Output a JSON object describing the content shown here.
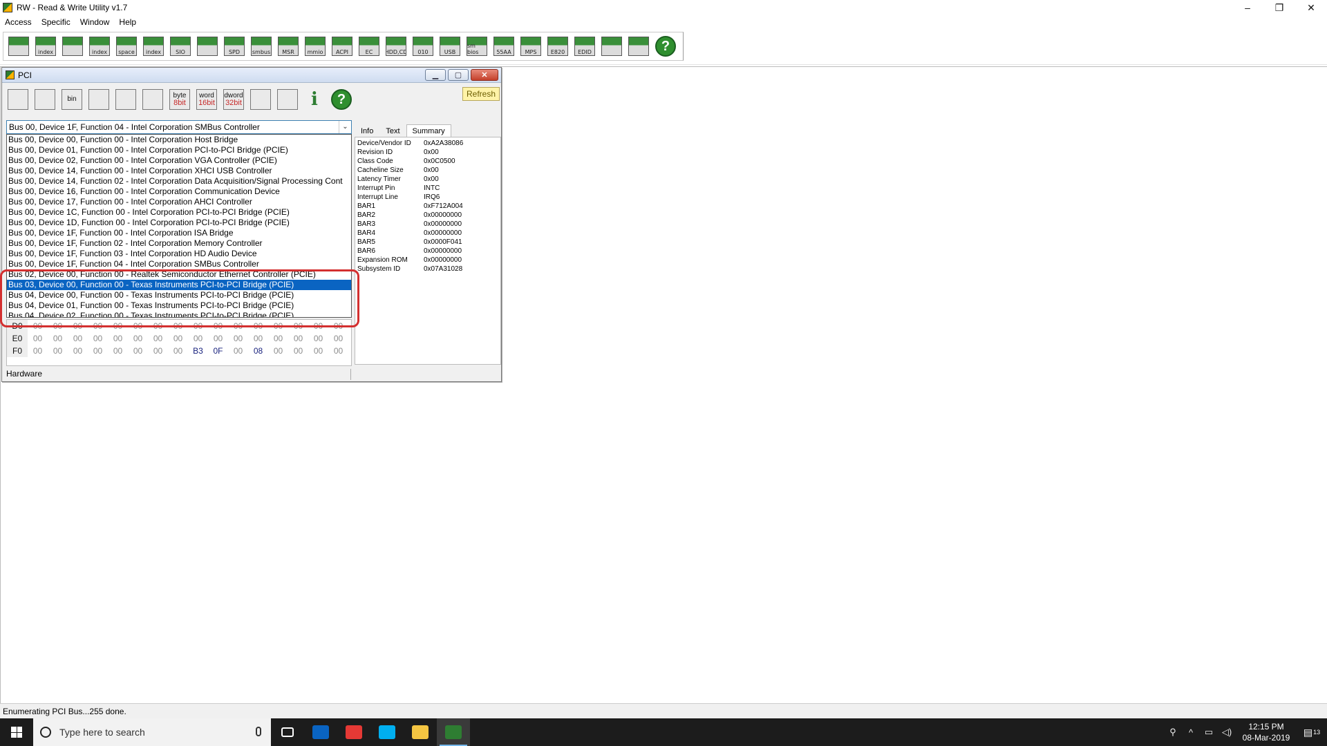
{
  "app": {
    "title": "RW - Read & Write Utility v1.7",
    "controls": {
      "minimize": "–",
      "restore": "❐",
      "close": "✕"
    }
  },
  "menu": [
    "Access",
    "Specific",
    "Window",
    "Help"
  ],
  "main_toolbar": {
    "buttons": [
      {
        "name": "pci-icon",
        "label": ""
      },
      {
        "name": "pci-index-icon",
        "label": "index"
      },
      {
        "name": "memory-icon",
        "label": ""
      },
      {
        "name": "memory-index-icon",
        "label": "index"
      },
      {
        "name": "io-space-icon",
        "label": "space"
      },
      {
        "name": "io-index-icon",
        "label": "index"
      },
      {
        "name": "sio-icon",
        "label": "SIO"
      },
      {
        "name": "oscilloscope-icon",
        "label": ""
      },
      {
        "name": "spd-icon",
        "label": "SPD"
      },
      {
        "name": "smbus-icon",
        "label": "smbus"
      },
      {
        "name": "msr-icon",
        "label": "MSR"
      },
      {
        "name": "mmio-icon",
        "label": "mmio"
      },
      {
        "name": "acpi-icon",
        "label": "ACPI"
      },
      {
        "name": "ec-icon",
        "label": "EC"
      },
      {
        "name": "hdd-icon",
        "label": "HDD,CD"
      },
      {
        "name": "cmos-icon",
        "label": "010"
      },
      {
        "name": "usb-icon",
        "label": "USB"
      },
      {
        "name": "smbios-icon",
        "label": "sm bios"
      },
      {
        "name": "rom-55aa-icon",
        "label": "55AA"
      },
      {
        "name": "mps-icon",
        "label": "MPS"
      },
      {
        "name": "e820-icon",
        "label": "E820"
      },
      {
        "name": "edid-icon",
        "label": "EDID"
      },
      {
        "name": "command-icon",
        "label": ""
      },
      {
        "name": "tools-icon",
        "label": ""
      }
    ],
    "colors": {
      "accent": "#2e7d32"
    }
  },
  "pci_window": {
    "title": "PCI",
    "controls": {
      "minimize": "▁",
      "maximize": "▢",
      "close": "✕"
    },
    "toolbar": {
      "buttons": [
        {
          "name": "save-icon",
          "top": "",
          "bottom": ""
        },
        {
          "name": "save-all-icon",
          "top": "",
          "bottom": ""
        },
        {
          "name": "bin-icon",
          "top": "bin",
          "bottom": ""
        },
        {
          "name": "open-icon",
          "top": "",
          "bottom": ""
        },
        {
          "name": "find-icon",
          "top": "",
          "bottom": ""
        },
        {
          "name": "window-icon",
          "top": "",
          "bottom": ""
        },
        {
          "name": "byte-icon",
          "top": "byte",
          "bottom": "8bit"
        },
        {
          "name": "word-icon",
          "top": "word",
          "bottom": "16bit"
        },
        {
          "name": "dword-icon",
          "top": "dword",
          "bottom": "32bit"
        },
        {
          "name": "list-icon",
          "top": "",
          "bottom": ""
        },
        {
          "name": "disc-icon",
          "top": "",
          "bottom": ""
        }
      ],
      "refresh_label": "Refresh"
    },
    "device_selector": {
      "selected_value": "Bus 00, Device 1F, Function 04 - Intel Corporation SMBus Controller",
      "options": [
        "Bus 00, Device 00, Function 00 - Intel Corporation Host Bridge",
        "Bus 00, Device 01, Function 00 - Intel Corporation PCI-to-PCI Bridge (PCIE)",
        "Bus 00, Device 02, Function 00 - Intel Corporation VGA Controller (PCIE)",
        "Bus 00, Device 14, Function 00 - Intel Corporation XHCI USB Controller",
        "Bus 00, Device 14, Function 02 - Intel Corporation Data Acquisition/Signal Processing Cont",
        "Bus 00, Device 16, Function 00 - Intel Corporation Communication Device",
        "Bus 00, Device 17, Function 00 - Intel Corporation AHCI Controller",
        "Bus 00, Device 1C, Function 00 - Intel Corporation PCI-to-PCI Bridge (PCIE)",
        "Bus 00, Device 1D, Function 00 - Intel Corporation PCI-to-PCI Bridge (PCIE)",
        "Bus 00, Device 1F, Function 00 - Intel Corporation ISA Bridge",
        "Bus 00, Device 1F, Function 02 - Intel Corporation Memory Controller",
        "Bus 00, Device 1F, Function 03 - Intel Corporation HD Audio Device",
        "Bus 00, Device 1F, Function 04 - Intel Corporation SMBus Controller",
        "Bus 02, Device 00, Function 00 - Realtek Semiconductor Ethernet Controller (PCIE)",
        "Bus 03, Device 00, Function 00 - Texas Instruments PCI-to-PCI Bridge (PCIE)",
        "Bus 04, Device 00, Function 00 - Texas Instruments PCI-to-PCI Bridge (PCIE)",
        "Bus 04, Device 01, Function 00 - Texas Instruments PCI-to-PCI Bridge (PCIE)",
        "Bus 04, Device 02, Function 00 - Texas Instruments PCI-to-PCI Bridge (PCIE)"
      ],
      "highlighted_index": 14,
      "annotation_color": "#d32f2f"
    },
    "hex_rows": [
      {
        "label": "D0",
        "cells": [
          "00",
          "00",
          "00",
          "00",
          "00",
          "00",
          "00",
          "00",
          "00",
          "00",
          "00",
          "00",
          "00",
          "00",
          "00",
          "00"
        ]
      },
      {
        "label": "E0",
        "cells": [
          "00",
          "00",
          "00",
          "00",
          "00",
          "00",
          "00",
          "00",
          "00",
          "00",
          "00",
          "00",
          "00",
          "00",
          "00",
          "00"
        ]
      },
      {
        "label": "F0",
        "cells": [
          "00",
          "00",
          "00",
          "00",
          "00",
          "00",
          "00",
          "00",
          "B3",
          "0F",
          "00",
          "08",
          "00",
          "00",
          "00",
          "00"
        ]
      }
    ],
    "status_label": "Hardware",
    "tabs": [
      "Info",
      "Text",
      "Summary"
    ],
    "active_tab": 2,
    "summary": [
      {
        "key": "Device/Vendor ID",
        "value": "0xA2A38086"
      },
      {
        "key": "Revision ID",
        "value": "0x00"
      },
      {
        "key": "Class Code",
        "value": "0x0C0500"
      },
      {
        "key": "Cacheline Size",
        "value": "0x00"
      },
      {
        "key": "Latency Timer",
        "value": "0x00"
      },
      {
        "key": "Interrupt Pin",
        "value": "INTC"
      },
      {
        "key": "Interrupt Line",
        "value": "IRQ6"
      },
      {
        "key": "BAR1",
        "value": "0xF712A004"
      },
      {
        "key": "BAR2",
        "value": "0x00000000"
      },
      {
        "key": "BAR3",
        "value": "0x00000000"
      },
      {
        "key": "BAR4",
        "value": "0x00000000"
      },
      {
        "key": "BAR5",
        "value": "0x0000F041"
      },
      {
        "key": "BAR6",
        "value": "0x00000000"
      },
      {
        "key": "Expansion ROM",
        "value": "0x00000000"
      },
      {
        "key": "Subsystem ID",
        "value": "0x07A31028"
      }
    ]
  },
  "statusbar": {
    "text": "Enumerating PCI Bus...255 done."
  },
  "taskbar": {
    "search_placeholder": "Type here to search",
    "apps": [
      {
        "name": "task-view-icon",
        "color": "#1c1c1c",
        "active": false
      },
      {
        "name": "outlook-icon",
        "color": "#0a64c2",
        "active": false
      },
      {
        "name": "chrome-icon",
        "color": "#e53935",
        "active": false
      },
      {
        "name": "skype-icon",
        "color": "#00aff0",
        "active": false
      },
      {
        "name": "file-explorer-icon",
        "color": "#f4c542",
        "active": false
      },
      {
        "name": "rw-utility-icon",
        "color": "#2e7d32",
        "active": true
      }
    ],
    "clock_time": "12:15 PM",
    "clock_date": "08-Mar-2019",
    "notification_count": "13"
  }
}
